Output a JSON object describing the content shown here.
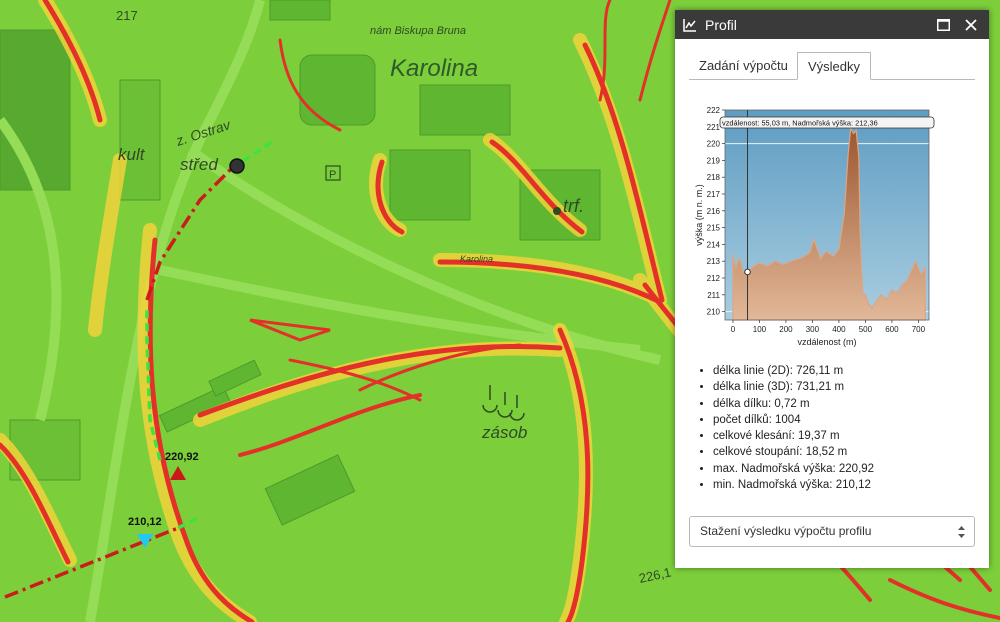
{
  "map": {
    "labels": {
      "karolina": "Karolina",
      "street": "nám Biskupa Bruna",
      "ostrava": "z. Ostrav",
      "kult": "kult",
      "stred": "střed",
      "trf": "trf.",
      "zasob": "zásob",
      "contour": "226,1",
      "parking": "P",
      "num_217": "217",
      "karolina_small": "Karolina"
    },
    "markers": {
      "max_label": "220,92",
      "min_label": "210,12"
    },
    "colors": {
      "base": "#7ccf3a",
      "high_slope": "#e3312a",
      "mid_slope": "#f2d33b",
      "profile_line": "#cc1b1b"
    }
  },
  "panel": {
    "title": "Profil",
    "icons": {
      "app": "profile-chart-icon",
      "maximize": "maximize-icon",
      "close": "close-icon"
    },
    "tabs": [
      {
        "label": "Zadání výpočtu",
        "active": false
      },
      {
        "label": "Výsledky",
        "active": true
      }
    ],
    "stats": [
      "délka linie (2D): 726,11 m",
      "délka linie (3D): 731,21 m",
      "délka dílku: 0,72 m",
      "počet dílků: 1004",
      "celkové klesání: 19,37 m",
      "celkové stoupání: 18,52 m",
      "max. Nadmořská výška: 220,92",
      "min. Nadmořská výška: 210,12"
    ],
    "download_select": "Stažení výsledku výpočtu profilu"
  },
  "chart_data": {
    "type": "area",
    "xlabel": "vzdálenost (m)",
    "ylabel": "výška (m n. m.)",
    "xlim": [
      -30,
      740
    ],
    "ylim": [
      209.5,
      222
    ],
    "xticks": [
      0,
      100,
      200,
      300,
      400,
      500,
      600,
      700
    ],
    "yticks": [
      210,
      211,
      212,
      213,
      214,
      215,
      216,
      217,
      218,
      219,
      220,
      221,
      222
    ],
    "tooltip": "vzdálenost: 55,03 m, Nadmořská výška: 212,36",
    "cursor": {
      "x": 55.03,
      "y": 212.36
    },
    "grid_lines": [
      210,
      220
    ],
    "colors": {
      "area": "#b06a40",
      "area_top": "#d9a07a",
      "background": "#6fa8c8"
    },
    "x": [
      0,
      10,
      25,
      40,
      55,
      80,
      100,
      130,
      160,
      190,
      220,
      260,
      290,
      305,
      315,
      330,
      350,
      380,
      400,
      420,
      435,
      445,
      455,
      465,
      475,
      480,
      485,
      490,
      500,
      510,
      525,
      540,
      560,
      580,
      600,
      620,
      640,
      655,
      670,
      690,
      710,
      726
    ],
    "values": [
      213.4,
      212.6,
      213.2,
      212.3,
      212.36,
      212.7,
      212.9,
      212.7,
      213.0,
      212.8,
      213.0,
      213.2,
      213.5,
      214.3,
      213.9,
      213.1,
      213.6,
      213.3,
      213.7,
      215.8,
      219.4,
      220.92,
      220.6,
      220.8,
      219.2,
      214.8,
      212.6,
      211.1,
      211.0,
      210.5,
      210.2,
      210.6,
      211.0,
      210.7,
      211.3,
      211.1,
      211.6,
      211.8,
      212.3,
      213.0,
      212.2,
      212.6
    ]
  }
}
